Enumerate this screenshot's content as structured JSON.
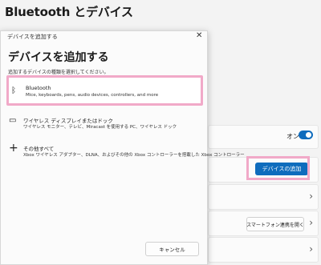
{
  "page": {
    "title": "Bluetooth とデバイス"
  },
  "settings": {
    "toggle_state": "オン",
    "add_device_label": "デバイスの追加",
    "phone_link_label": "スマートフォン連携を開く"
  },
  "dialog": {
    "titlebar": "デバイスを追加する",
    "close_glyph": "✕",
    "heading": "デバイスを追加する",
    "subtitle": "追加するデバイスの種類を選択してください。",
    "options": [
      {
        "icon": "bluetooth-icon",
        "glyph": "ᛒ",
        "title": "Bluetooth",
        "desc": "Mice, keyboards, pens, audio devices, controllers, and more"
      },
      {
        "icon": "monitor-icon",
        "glyph": "▭",
        "title": "ワイヤレス ディスプレイまたはドック",
        "desc": "ワイヤレス モニター、テレビ、Miracast を使用する PC、ワイヤレス ドック"
      },
      {
        "icon": "plus-icon",
        "glyph": "+",
        "title": "その他すべて",
        "desc": "Xbox ワイヤレス アダプター、DLNA、およびその他の Xbox コントローラーを搭載した Xbox コントローラー"
      }
    ],
    "cancel_label": "キャンセル"
  },
  "colors": {
    "accent": "#0f6cbd",
    "highlight": "#f1a9c8"
  }
}
